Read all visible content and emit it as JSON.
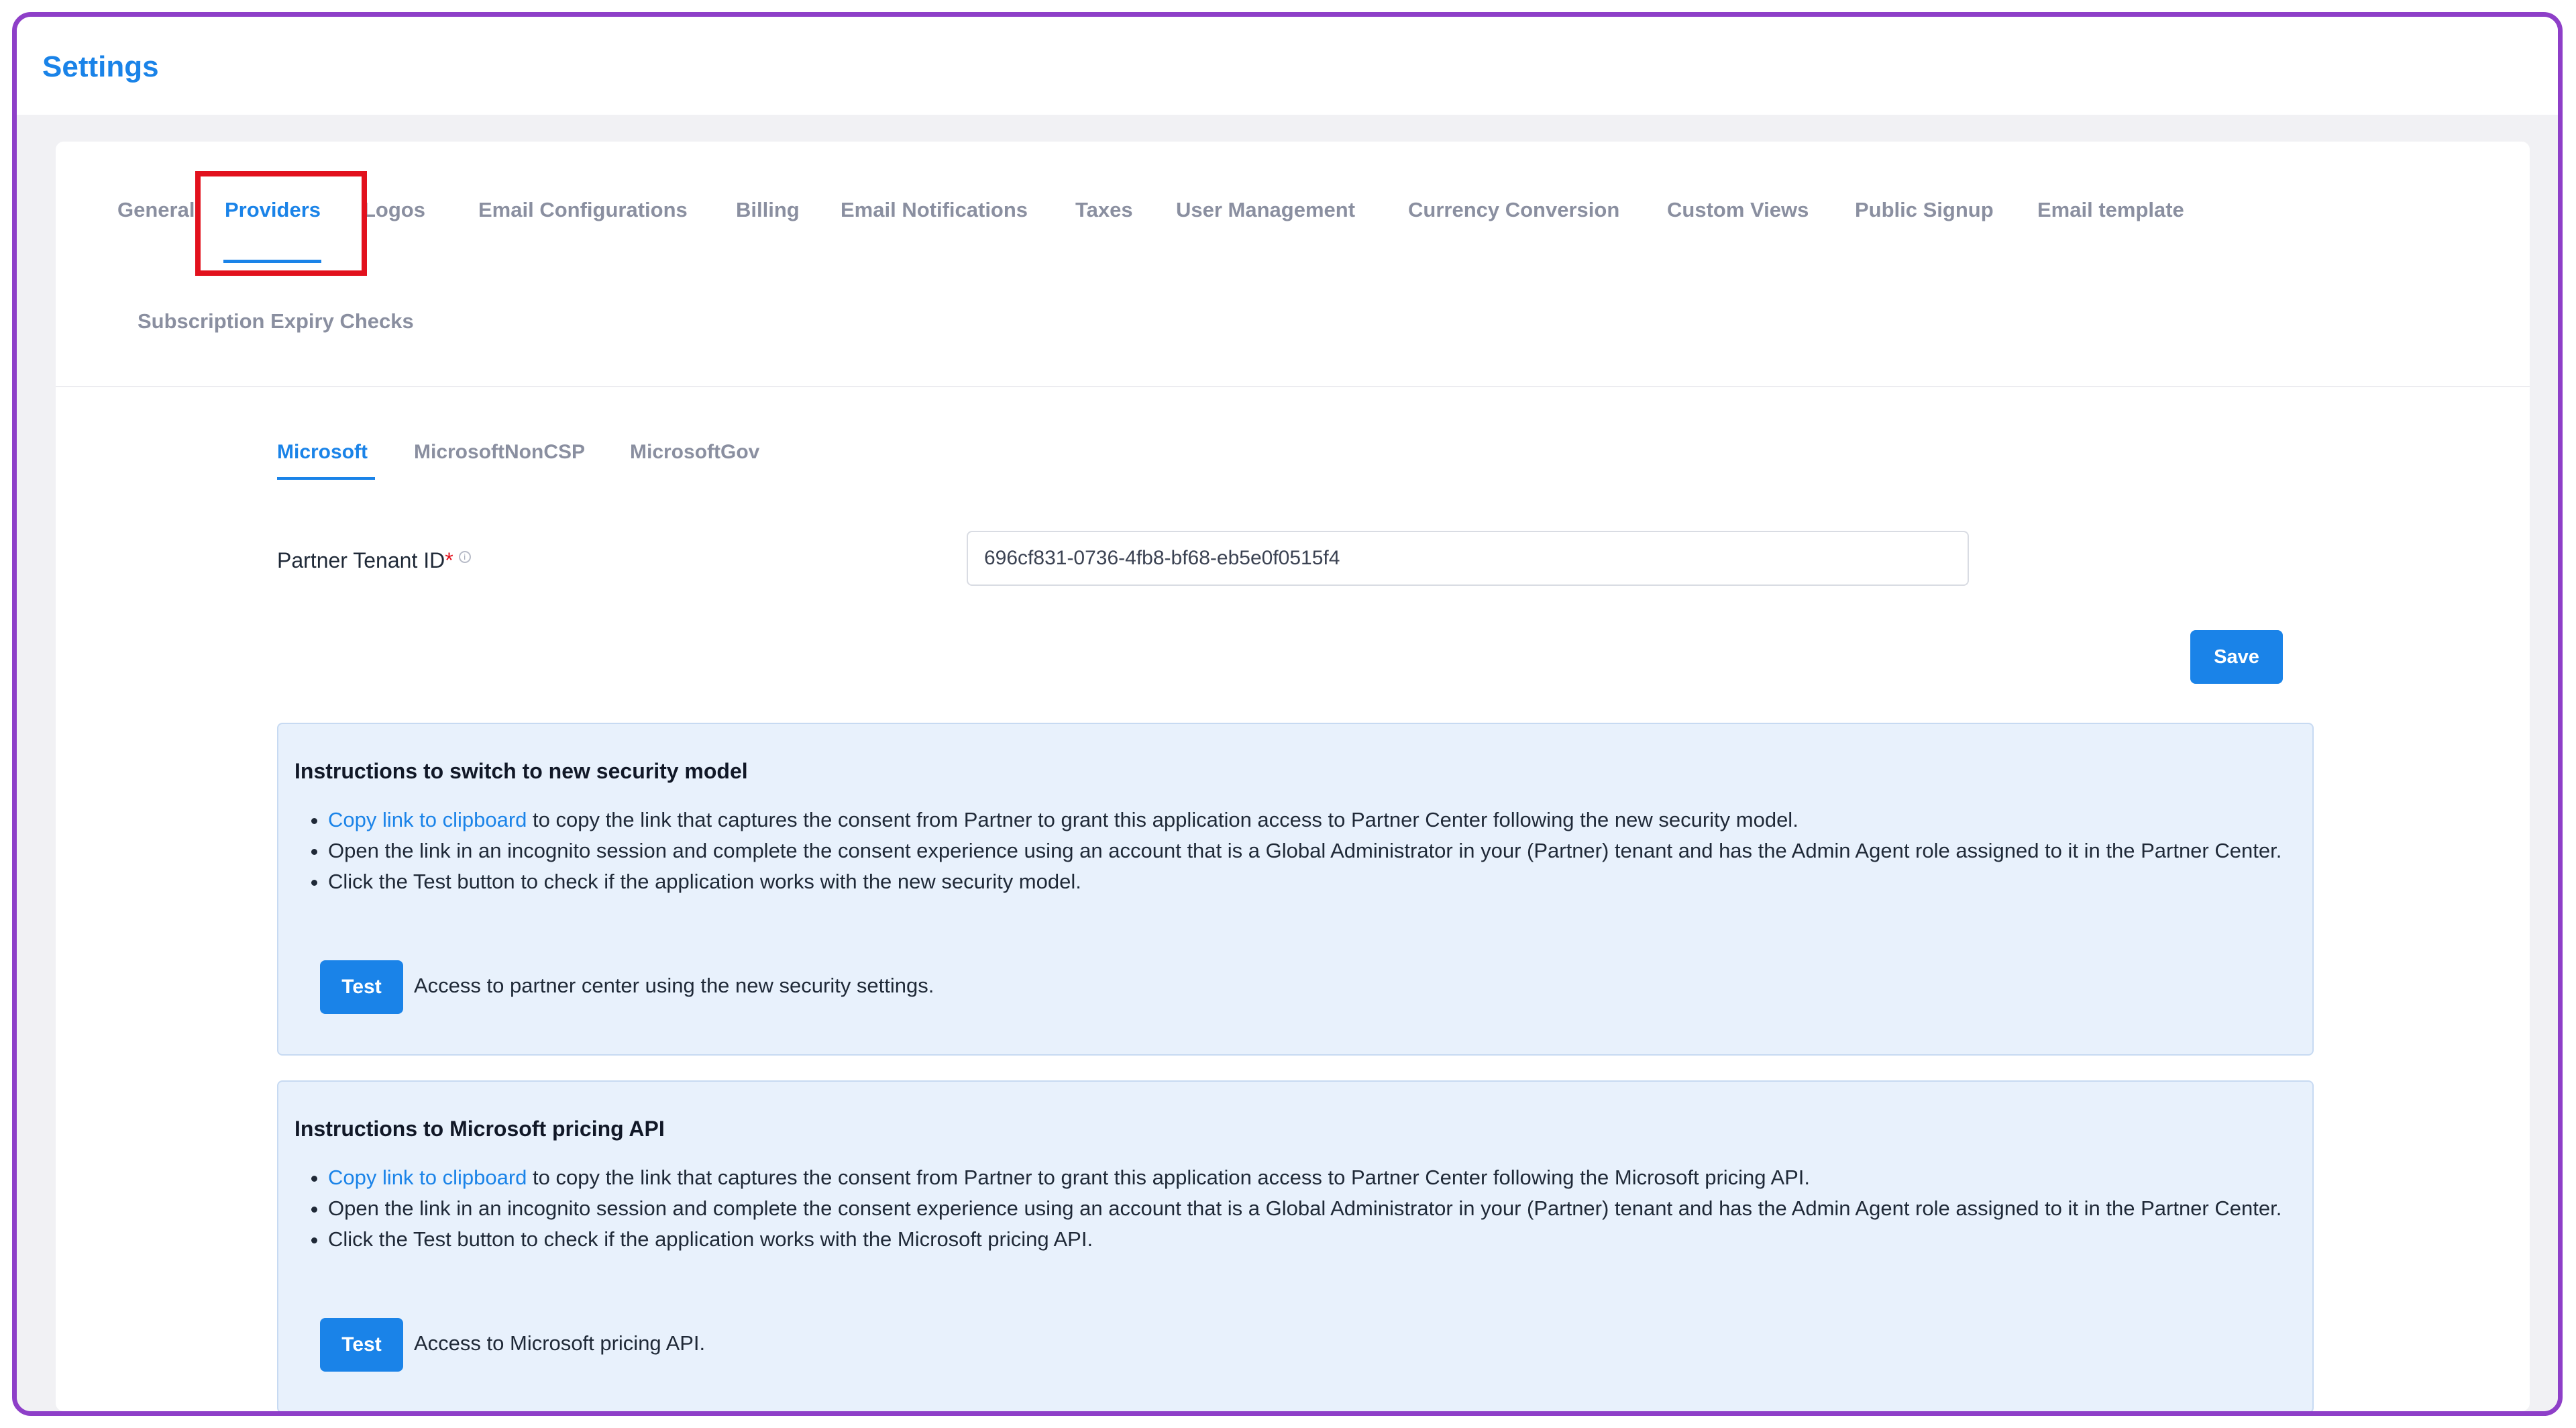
{
  "header": {
    "title": "Settings"
  },
  "tabs": [
    {
      "label": "General",
      "active": false
    },
    {
      "label": "Providers",
      "active": true
    },
    {
      "label": "Logos",
      "active": false
    },
    {
      "label": "Email Configurations",
      "active": false
    },
    {
      "label": "Billing",
      "active": false
    },
    {
      "label": "Email Notifications",
      "active": false
    },
    {
      "label": "Taxes",
      "active": false
    },
    {
      "label": "User Management",
      "active": false
    },
    {
      "label": "Currency Conversion",
      "active": false
    },
    {
      "label": "Custom Views",
      "active": false
    },
    {
      "label": "Public Signup",
      "active": false
    },
    {
      "label": "Email template",
      "active": false
    },
    {
      "label": "Subscription Expiry Checks",
      "active": false
    }
  ],
  "subtabs": [
    {
      "label": "Microsoft",
      "active": true
    },
    {
      "label": "MicrosoftNonCSP",
      "active": false
    },
    {
      "label": "MicrosoftGov",
      "active": false
    }
  ],
  "form": {
    "tenant_label": "Partner Tenant ID",
    "required_mark": "*",
    "tenant_value": "696cf831-0736-4fb8-bf68-eb5e0f0515f4",
    "save_label": "Save"
  },
  "panels": [
    {
      "title": "Instructions to switch to new security model",
      "link_text": "Copy link to clipboard",
      "item1_rest": " to copy the link that captures the consent from Partner to grant this application access to Partner Center following the new security model.",
      "item2": "Open the link in an incognito session and complete the consent experience using an account that is a Global Administrator in your (Partner) tenant and has the Admin Agent role assigned to it in the Partner Center.",
      "item3": "Click the Test button to check if the application works with the new security model.",
      "test_label": "Test",
      "test_desc": "Access to partner center using the new security settings."
    },
    {
      "title": "Instructions to Microsoft pricing API",
      "link_text": "Copy link to clipboard",
      "item1_rest": " to copy the link that captures the consent from Partner to grant this application access to Partner Center following the Microsoft pricing API.",
      "item2": "Open the link in an incognito session and complete the consent experience using an account that is a Global Administrator in your (Partner) tenant and has the Admin Agent role assigned to it in the Partner Center.",
      "item3": "Click the Test button to check if the application works with the Microsoft pricing API.",
      "test_label": "Test",
      "test_desc": "Access to Microsoft pricing API."
    }
  ],
  "colors": {
    "accent": "#1a83e8",
    "frame": "#8e3fc8",
    "highlight": "#e2111d",
    "panel_bg": "#e8f1fc"
  },
  "icons": {
    "info": "info-circle-icon"
  }
}
